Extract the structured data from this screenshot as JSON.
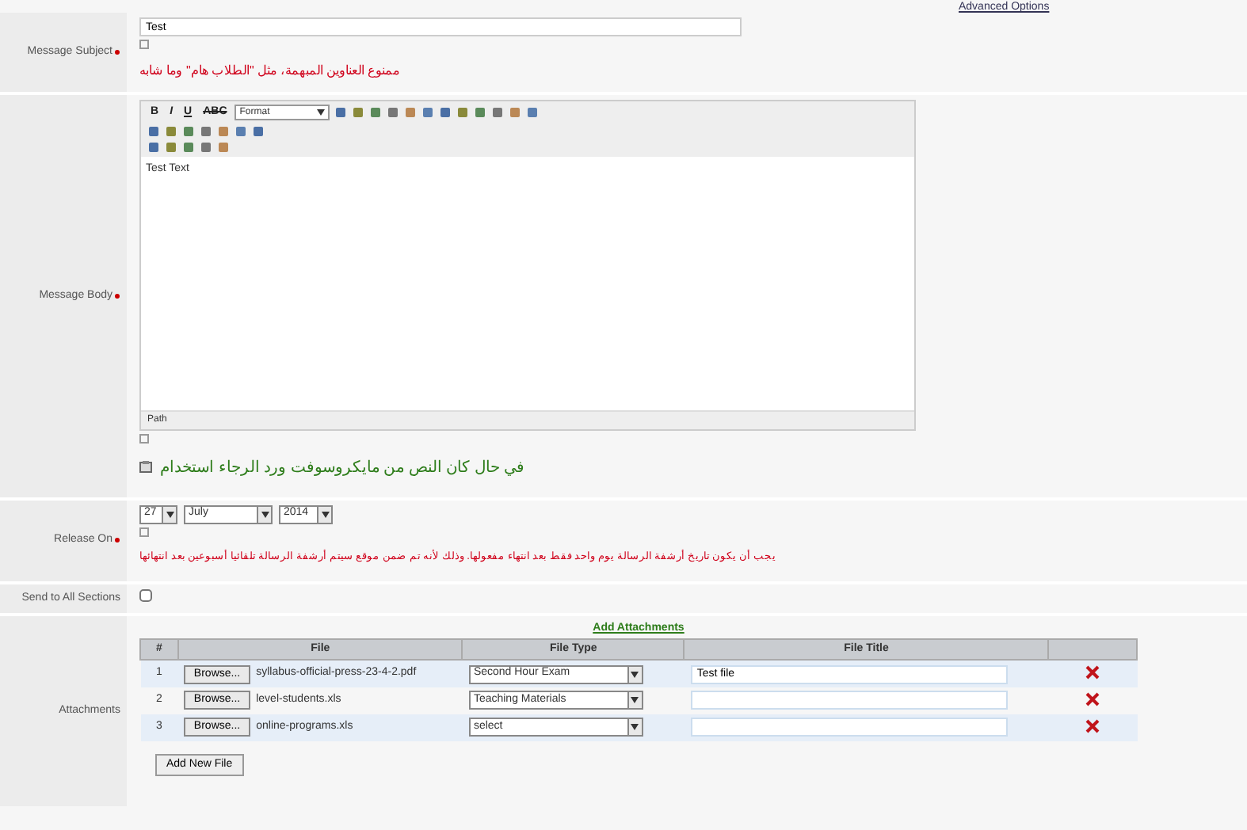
{
  "advanced_link": "Advanced Options",
  "subject": {
    "label": "Message Subject",
    "required": true,
    "value": "Test",
    "note": "ممنوع العناوين المبهمة، مثل \"الطلاب هام\" وما شابه"
  },
  "body": {
    "label": "Message Body",
    "required": true,
    "toolbar_text": [
      "B",
      "I",
      "U",
      "ABC"
    ],
    "format_select": "Format",
    "text": "Test Text",
    "path_label": "Path",
    "word_note": "في حال كان النص من مايكروسوفت ورد الرجاء استخدام"
  },
  "release": {
    "label": "Release On",
    "required": true,
    "day": "27",
    "month": "July",
    "year": "2014",
    "note": "يجب أن يكون تاريخ أرشفة الرسالة يوم واحد فقط بعد انتهاء مفعولها. وذلك لأنه تم ضمن موقع سيتم أرشفة الرسالة تلقائيا أسبوعين بعد انتهائها"
  },
  "send_all": {
    "label": "Send to All Sections",
    "checked": false
  },
  "attachments": {
    "label": "Attachments",
    "title": "Add Attachments",
    "columns": [
      "#",
      "File",
      "File Type",
      "File Title"
    ],
    "rows": [
      {
        "number": "1",
        "browse_label": "Browse...",
        "file": "syllabus-official-press-23-4-2.pdf",
        "type": "Second Hour Exam",
        "title": "Test file"
      },
      {
        "number": "2",
        "browse_label": "Browse...",
        "file": "level-students.xls",
        "type": "Teaching Materials",
        "title": ""
      },
      {
        "number": "3",
        "browse_label": "Browse...",
        "file": "online-programs.xls",
        "type": "select",
        "title": ""
      }
    ],
    "add_button": "Add New File"
  }
}
